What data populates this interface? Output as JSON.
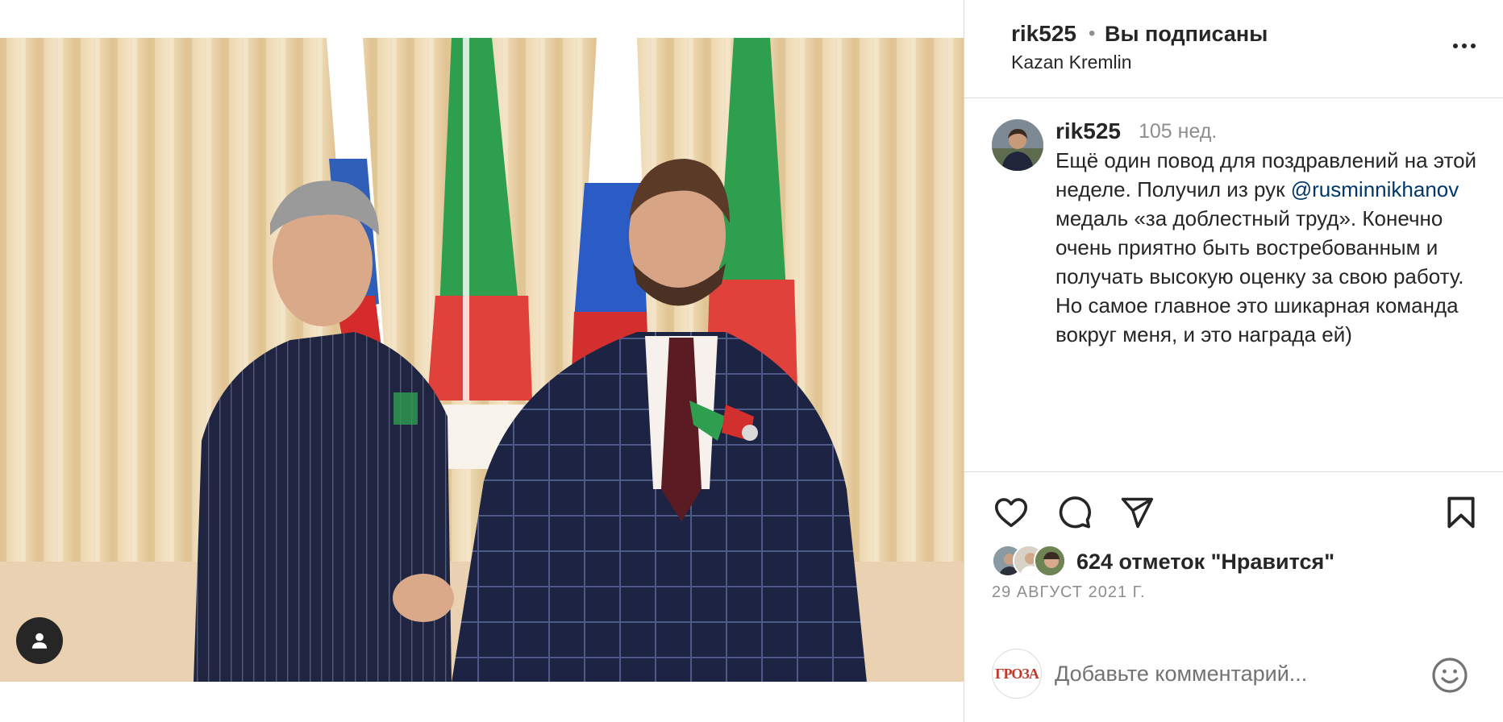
{
  "header": {
    "username": "rik525",
    "separator": "•",
    "follow_status": "Вы подписаны",
    "location": "Kazan Kremlin"
  },
  "caption": {
    "username": "rik525",
    "time_ago": "105 нед.",
    "text_before": "Ещё один повод для поздравлений на этой неделе. Получил из рук ",
    "mention": "@rusminnikhanov",
    "text_after": " медаль «за доблестный труд». Конечно очень приятно быть востребованным и получать высокую оценку за свою работу. Но самое главное это шикарная команда вокруг меня, и это награда ей)"
  },
  "actions": {
    "like_icon": "heart-icon",
    "comment_icon": "comment-icon",
    "share_icon": "paper-plane-icon",
    "save_icon": "bookmark-icon"
  },
  "likes": {
    "count_text": "624 отметок \"Нравится\""
  },
  "post_date": "29 АВГУСТ 2021 Г.",
  "comment": {
    "avatar_text": "ГРОЗА",
    "placeholder": "Добавьте комментарий...",
    "emoji_icon": "emoji-smile-icon"
  },
  "media": {
    "tag_icon": "user-tag-icon"
  },
  "colors": {
    "text": "#262626",
    "secondary": "#8e8e8e",
    "mention": "#00376b",
    "divider": "#dbdbdb"
  }
}
